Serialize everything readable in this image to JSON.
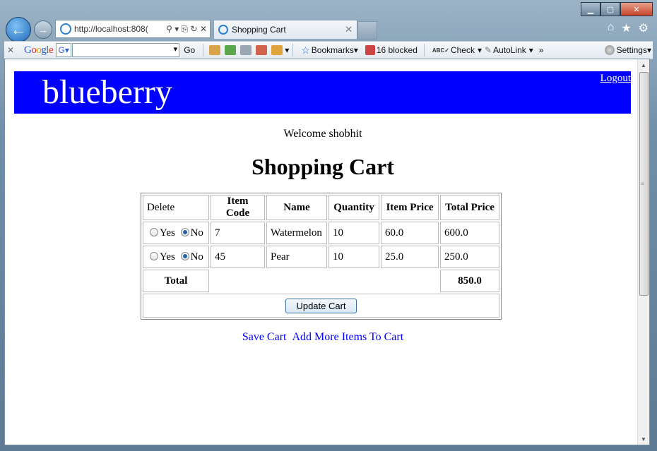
{
  "browser": {
    "address": "http://localhost:808(",
    "tab_title": "Shopping Cart",
    "toolbar": {
      "go": "Go",
      "bookmarks": "Bookmarks▾",
      "blocked": "16 blocked",
      "check": "Check",
      "autolink": "AutoLink",
      "settings": "Settings▾"
    }
  },
  "page": {
    "brand": "blueberry",
    "logout": "Logout",
    "welcome": "Welcome shobhit",
    "title": "Shopping Cart",
    "table": {
      "headers": [
        "Delete",
        "Item Code",
        "Name",
        "Quantity",
        "Item Price",
        "Total Price"
      ],
      "yes_label": "Yes",
      "no_label": "No",
      "rows": [
        {
          "code": "7",
          "name": "Watermelon",
          "qty": "10",
          "price": "60.0",
          "total": "600.0"
        },
        {
          "code": "45",
          "name": "Pear",
          "qty": "10",
          "price": "25.0",
          "total": "250.0"
        }
      ],
      "total_label": "Total",
      "total_value": "850.0",
      "update_button": "Update Cart"
    },
    "links": {
      "save": "Save Cart",
      "add_more": "Add More Items To Cart"
    }
  },
  "colors": {
    "banner": "#0000ff",
    "link": "#0000ff"
  }
}
